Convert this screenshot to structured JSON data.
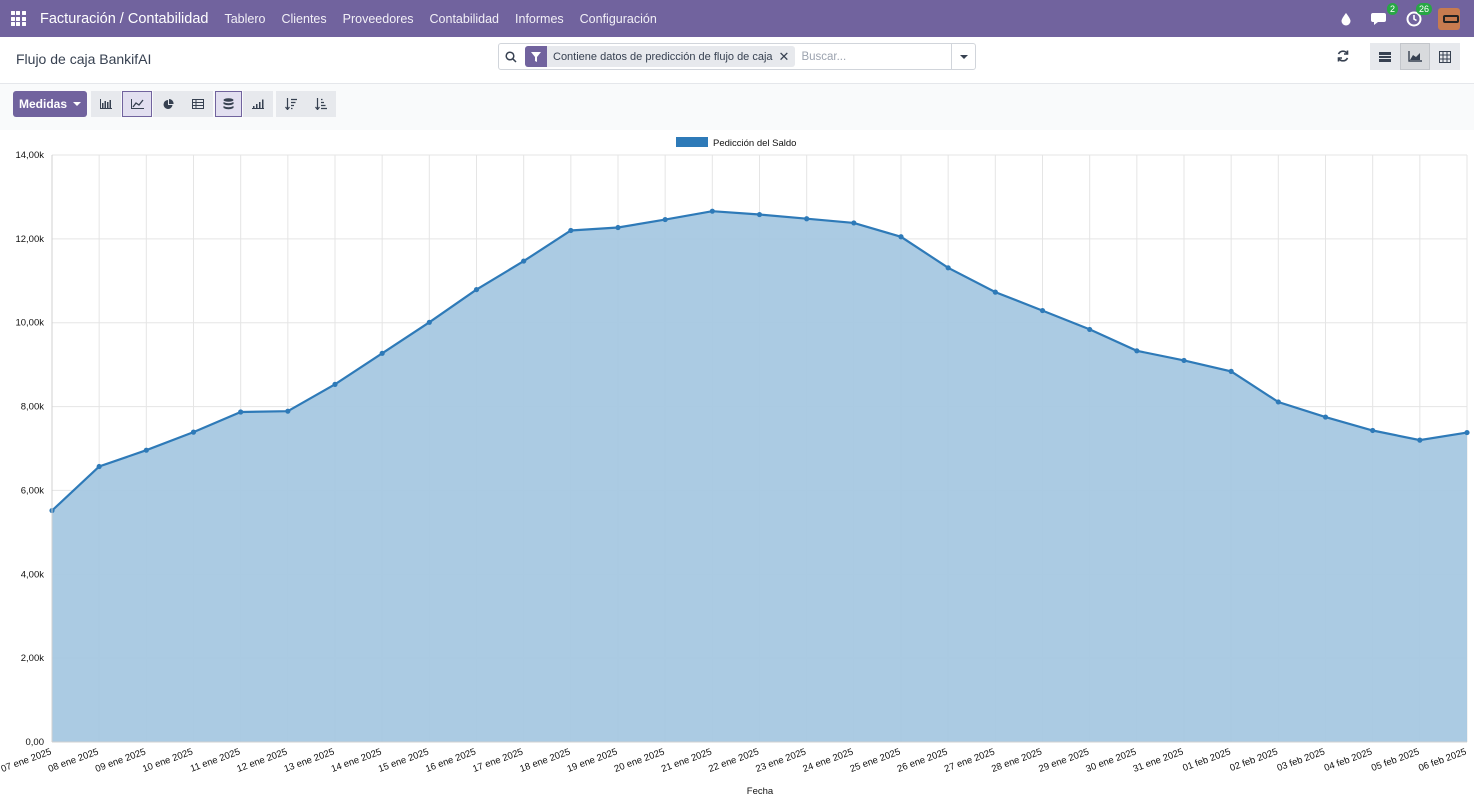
{
  "topnav": {
    "app_title": "Facturación / Contabilidad",
    "items": [
      {
        "label": "Tablero"
      },
      {
        "label": "Clientes"
      },
      {
        "label": "Proveedores"
      },
      {
        "label": "Contabilidad"
      },
      {
        "label": "Informes"
      },
      {
        "label": "Configuración"
      }
    ],
    "messages_badge": "2",
    "activities_badge": "26"
  },
  "control": {
    "breadcrumb": "Flujo de caja BankifAI",
    "facet": "Contiene datos de predicción de flujo de caja",
    "search_placeholder": "Buscar..."
  },
  "toolbar": {
    "measures_label": "Medidas"
  },
  "colors": {
    "brand": "#71639e",
    "series_line": "#2e7ab8",
    "series_fill": "#a7c8e1"
  },
  "chart_data": {
    "type": "area",
    "legend": [
      "Pedicción del Saldo"
    ],
    "legend_position": "top",
    "xlabel": "Fecha",
    "ylabel": "",
    "ylim": [
      0,
      14000
    ],
    "yticks": [
      "0,00",
      "2,00k",
      "4,00k",
      "6,00k",
      "8,00k",
      "10,00k",
      "12,00k",
      "14,00k"
    ],
    "grid": true,
    "categories": [
      "07 ene 2025",
      "08 ene 2025",
      "09 ene 2025",
      "10 ene 2025",
      "11 ene 2025",
      "12 ene 2025",
      "13 ene 2025",
      "14 ene 2025",
      "15 ene 2025",
      "16 ene 2025",
      "17 ene 2025",
      "18 ene 2025",
      "19 ene 2025",
      "20 ene 2025",
      "21 ene 2025",
      "22 ene 2025",
      "23 ene 2025",
      "24 ene 2025",
      "25 ene 2025",
      "26 ene 2025",
      "27 ene 2025",
      "28 ene 2025",
      "29 ene 2025",
      "30 ene 2025",
      "31 ene 2025",
      "01 feb 2025",
      "02 feb 2025",
      "03 feb 2025",
      "04 feb 2025",
      "05 feb 2025",
      "06 feb 2025"
    ],
    "series": [
      {
        "name": "Pedicción del Saldo",
        "values": [
          5520,
          6570,
          6960,
          7390,
          7870,
          7890,
          8530,
          9270,
          10010,
          10790,
          11470,
          12200,
          12270,
          12460,
          12660,
          12580,
          12480,
          12380,
          12050,
          11310,
          10730,
          10290,
          9840,
          9330,
          9100,
          8840,
          8110,
          7750,
          7430,
          7200,
          7380
        ]
      }
    ]
  }
}
